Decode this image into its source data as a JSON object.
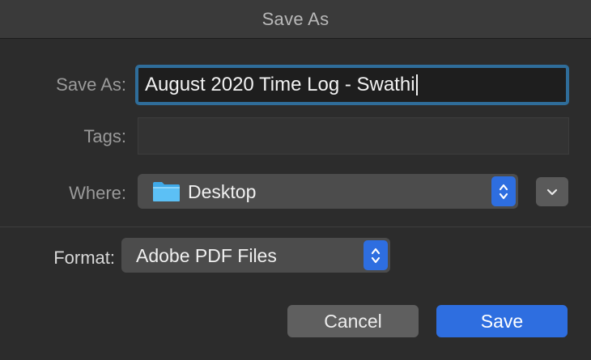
{
  "dialog": {
    "title": "Save As"
  },
  "save_as": {
    "label": "Save As:",
    "value": "August 2020 Time Log - Swathi"
  },
  "tags": {
    "label": "Tags:",
    "value": ""
  },
  "where": {
    "label": "Where:",
    "value": "Desktop",
    "icon": "folder-icon"
  },
  "format": {
    "label": "Format:",
    "value": "Adobe PDF Files"
  },
  "buttons": {
    "cancel": "Cancel",
    "save": "Save"
  },
  "colors": {
    "accent": "#2e6ee0",
    "focus_ring": "#2f6d9a",
    "folder": "#3fa9e8"
  }
}
